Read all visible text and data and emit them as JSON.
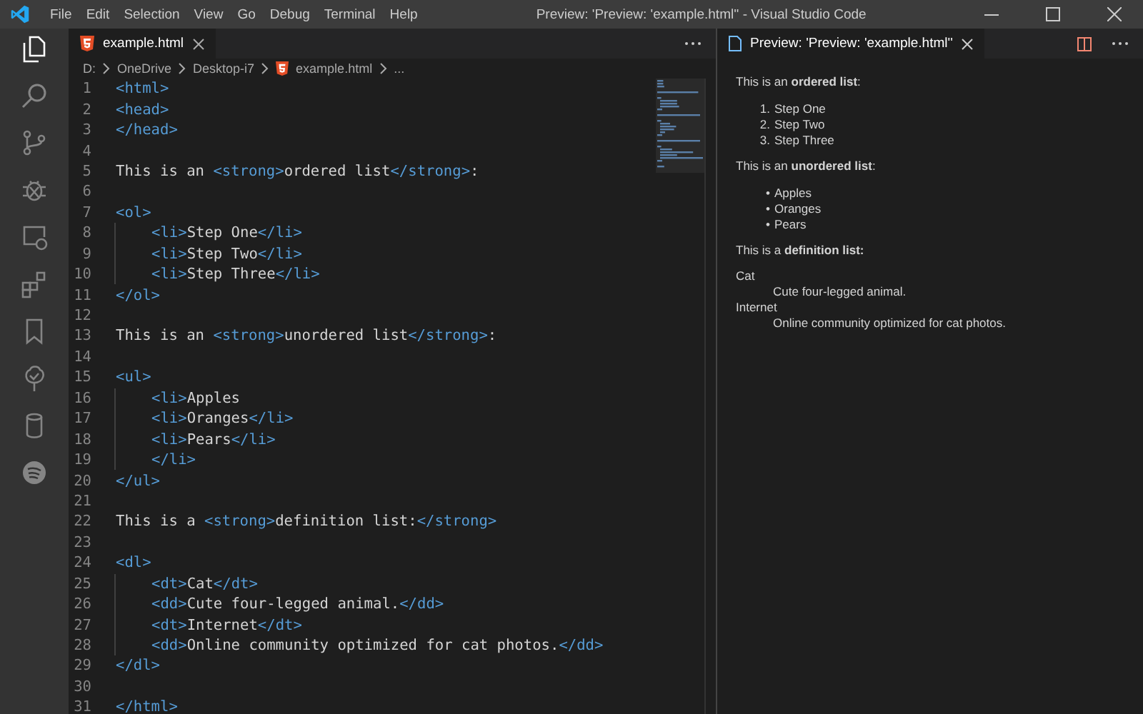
{
  "window": {
    "title": "Preview: 'Preview: 'example.html'' - Visual Studio Code"
  },
  "menu": [
    "File",
    "Edit",
    "Selection",
    "View",
    "Go",
    "Debug",
    "Terminal",
    "Help"
  ],
  "activity_bar": [
    {
      "kind": "files",
      "selected": true
    },
    {
      "kind": "search",
      "selected": false
    },
    {
      "kind": "branch",
      "selected": false
    },
    {
      "kind": "bug",
      "selected": false
    },
    {
      "kind": "remote",
      "selected": false
    },
    {
      "kind": "extensions",
      "selected": false
    },
    {
      "kind": "bookmark",
      "selected": false
    },
    {
      "kind": "tree",
      "selected": false
    },
    {
      "kind": "database",
      "selected": false
    },
    {
      "kind": "music",
      "selected": false
    }
  ],
  "editor": {
    "tabs": [
      {
        "label": "example.html",
        "selected": true
      }
    ],
    "breadcrumb": [
      "D:",
      "OneDrive",
      "Desktop-i7",
      "example.html",
      "..."
    ],
    "lines": [
      {
        "number": "1",
        "indented": false,
        "tokens": [
          {
            "kind": "tag",
            "text": "<html>"
          }
        ]
      },
      {
        "number": "2",
        "indented": false,
        "tokens": [
          {
            "kind": "tag",
            "text": "<head>"
          }
        ]
      },
      {
        "number": "3",
        "indented": false,
        "tokens": [
          {
            "kind": "tag",
            "text": "</head>"
          }
        ]
      },
      {
        "number": "4",
        "indented": false
      },
      {
        "number": "5",
        "indented": false,
        "tokens": [
          {
            "kind": "text",
            "text": "This is an "
          },
          {
            "kind": "tag",
            "text": "<strong>"
          },
          {
            "kind": "text",
            "text": "ordered list"
          },
          {
            "kind": "tag",
            "text": "</strong>"
          },
          {
            "kind": "text",
            "text": ":"
          }
        ]
      },
      {
        "number": "6",
        "indented": false
      },
      {
        "number": "7",
        "indented": false,
        "tokens": [
          {
            "kind": "tag",
            "text": "<ol>"
          }
        ]
      },
      {
        "number": "8",
        "indented": true,
        "tokens": [
          {
            "kind": "tag",
            "text": "<li>"
          },
          {
            "kind": "text",
            "text": "Step One"
          },
          {
            "kind": "tag",
            "text": "</li>"
          }
        ]
      },
      {
        "number": "9",
        "indented": true,
        "tokens": [
          {
            "kind": "tag",
            "text": "<li>"
          },
          {
            "kind": "text",
            "text": "Step Two"
          },
          {
            "kind": "tag",
            "text": "</li>"
          }
        ]
      },
      {
        "number": "10",
        "indented": true,
        "tokens": [
          {
            "kind": "tag",
            "text": "<li>"
          },
          {
            "kind": "text",
            "text": "Step Three"
          },
          {
            "kind": "tag",
            "text": "</li>"
          }
        ]
      },
      {
        "number": "11",
        "indented": false,
        "tokens": [
          {
            "kind": "tag",
            "text": "</ol>"
          }
        ]
      },
      {
        "number": "12",
        "indented": false
      },
      {
        "number": "13",
        "indented": false,
        "tokens": [
          {
            "kind": "text",
            "text": "This is an "
          },
          {
            "kind": "tag",
            "text": "<strong>"
          },
          {
            "kind": "text",
            "text": "unordered list"
          },
          {
            "kind": "tag",
            "text": "</strong>"
          },
          {
            "kind": "text",
            "text": ":"
          }
        ]
      },
      {
        "number": "14",
        "indented": false
      },
      {
        "number": "15",
        "indented": false,
        "tokens": [
          {
            "kind": "tag",
            "text": "<ul>"
          }
        ]
      },
      {
        "number": "16",
        "indented": true,
        "tokens": [
          {
            "kind": "tag",
            "text": "<li>"
          },
          {
            "kind": "text",
            "text": "Apples"
          }
        ]
      },
      {
        "number": "17",
        "indented": true,
        "tokens": [
          {
            "kind": "tag",
            "text": "<li>"
          },
          {
            "kind": "text",
            "text": "Oranges"
          },
          {
            "kind": "tag",
            "text": "</li>"
          }
        ]
      },
      {
        "number": "18",
        "indented": true,
        "tokens": [
          {
            "kind": "tag",
            "text": "<li>"
          },
          {
            "kind": "text",
            "text": "Pears"
          },
          {
            "kind": "tag",
            "text": "</li>"
          }
        ]
      },
      {
        "number": "19",
        "indented": true,
        "tokens": [
          {
            "kind": "tag",
            "text": "</li>"
          }
        ]
      },
      {
        "number": "20",
        "indented": false,
        "tokens": [
          {
            "kind": "tag",
            "text": "</ul>"
          }
        ]
      },
      {
        "number": "21",
        "indented": false
      },
      {
        "number": "22",
        "indented": false,
        "tokens": [
          {
            "kind": "text",
            "text": "This is a "
          },
          {
            "kind": "tag",
            "text": "<strong>"
          },
          {
            "kind": "text",
            "text": "definition list:"
          },
          {
            "kind": "tag",
            "text": "</strong>"
          }
        ]
      },
      {
        "number": "23",
        "indented": false
      },
      {
        "number": "24",
        "indented": false,
        "tokens": [
          {
            "kind": "tag",
            "text": "<dl>"
          }
        ]
      },
      {
        "number": "25",
        "indented": true,
        "tokens": [
          {
            "kind": "tag",
            "text": "<dt>"
          },
          {
            "kind": "text",
            "text": "Cat"
          },
          {
            "kind": "tag",
            "text": "</dt>"
          }
        ]
      },
      {
        "number": "26",
        "indented": true,
        "tokens": [
          {
            "kind": "tag",
            "text": "<dd>"
          },
          {
            "kind": "text",
            "text": "Cute four-legged animal."
          },
          {
            "kind": "tag",
            "text": "</dd>"
          }
        ]
      },
      {
        "number": "27",
        "indented": true,
        "tokens": [
          {
            "kind": "tag",
            "text": "<dt>"
          },
          {
            "kind": "text",
            "text": "Internet"
          },
          {
            "kind": "tag",
            "text": "</dt>"
          }
        ]
      },
      {
        "number": "28",
        "indented": true,
        "tokens": [
          {
            "kind": "tag",
            "text": "<dd>"
          },
          {
            "kind": "text",
            "text": "Online community optimized for cat photos."
          },
          {
            "kind": "tag",
            "text": "</dd>"
          }
        ]
      },
      {
        "number": "29",
        "indented": false,
        "tokens": [
          {
            "kind": "tag",
            "text": "</dl>"
          }
        ]
      },
      {
        "number": "30",
        "indented": false
      },
      {
        "number": "31",
        "indented": false,
        "tokens": [
          {
            "kind": "tag",
            "text": "</html>"
          }
        ]
      }
    ]
  },
  "preview": {
    "tabs": [
      {
        "label": "Preview: 'Preview: 'example.html''",
        "selected": true
      }
    ],
    "blocks": [
      {
        "kind": "paragraph",
        "text": "This is an **ordered list**:"
      },
      {
        "kind": "list",
        "items": [
          {
            "marker": "1.",
            "text": "Step One"
          },
          {
            "marker": "2.",
            "text": "Step Two"
          },
          {
            "marker": "3.",
            "text": "Step Three"
          }
        ]
      },
      {
        "kind": "paragraph",
        "text": "This is an **unordered list**:"
      },
      {
        "kind": "list",
        "items": [
          {
            "marker": "•",
            "text": "Apples"
          },
          {
            "marker": "•",
            "text": "Oranges"
          },
          {
            "marker": "•",
            "text": "Pears"
          }
        ]
      },
      {
        "kind": "paragraph",
        "text": "This is a **definition list:**"
      },
      {
        "kind": "definitions",
        "items": [
          {
            "term": "Cat",
            "definition": "Cute four-legged animal."
          },
          {
            "term": "Internet",
            "definition": "Online community optimized for cat photos."
          }
        ]
      }
    ]
  }
}
